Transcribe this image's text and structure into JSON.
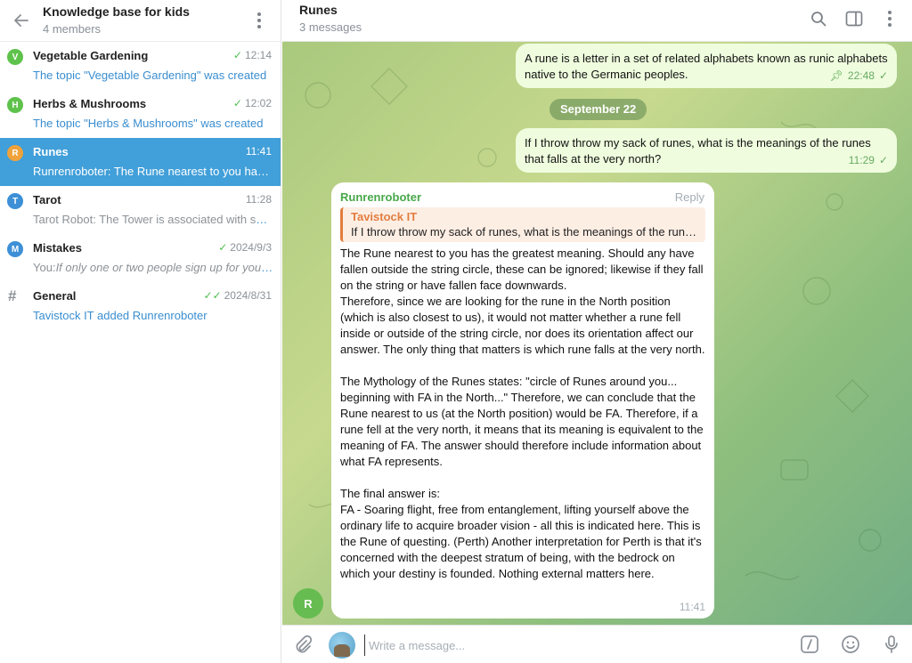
{
  "group": {
    "title": "Knowledge base for kids",
    "subtitle": "4 members"
  },
  "chats": [
    {
      "avatar_letter": "V",
      "avatar_color": "#5ec24b",
      "name": "Vegetable Gardening",
      "check": "✓",
      "time": "12:14",
      "sender": "",
      "preview": "The topic \"Vegetable Gardening\" was created"
    },
    {
      "avatar_letter": "H",
      "avatar_color": "#5ec24b",
      "name": "Herbs & Mushrooms",
      "check": "✓",
      "time": "12:02",
      "sender": "",
      "preview": "The topic \"Herbs & Mushrooms\" was created"
    },
    {
      "avatar_letter": "R",
      "avatar_color": "#f0a23b",
      "name": "Runes",
      "check": "",
      "time": "11:41",
      "sender": "",
      "preview": "Runrenroboter: The Rune nearest to you has the greatest meaning. Should any have",
      "active": true
    },
    {
      "avatar_letter": "T",
      "avatar_color": "#3d8fd6",
      "name": "Tarot",
      "check": "",
      "time": "11:28",
      "sender": "Tarot Robot:",
      "preview": " The Tower is associated with sudden change"
    },
    {
      "avatar_letter": "M",
      "avatar_color": "#3d8fd6",
      "name": "Mistakes",
      "check": "✓",
      "time": "2024/9/3",
      "sender": "You:",
      "preview": "If only one or two people sign up for your class"
    },
    {
      "avatar_letter": "#",
      "avatar_color": "",
      "name": "General",
      "check": "✓✓",
      "time": "2024/8/31",
      "sender": "",
      "preview": "Tavistock IT added Runrenroboter"
    }
  ],
  "topic": {
    "title": "Runes",
    "subtitle": "3 messages"
  },
  "messages": {
    "m1": {
      "text": "A rune is a letter in a set of related alphabets known as runic alphabets native to the Germanic peoples.",
      "time": "22:48",
      "check": "✓"
    },
    "date_separator": "September 22",
    "m2": {
      "text": "If I throw throw my sack of runes, what is the meanings of the runes that falls at the very north?",
      "time": "11:29",
      "check": "✓"
    },
    "m3": {
      "author": "Runrenroboter",
      "reply_label": "Reply",
      "quote_author": "Tavistock IT",
      "quote_text": "If I throw throw my sack of runes, what is the meanings of the runes that falls at the very north?",
      "para1": "The Rune nearest to you has the greatest meaning. Should any have fallen outside the string circle, these can be ignored; likewise if they fall on the string or have fallen face downwards.",
      "para2": "Therefore, since we are looking for the rune in the North position (which is also closest to us), it would not matter whether a rune fell inside or outside of the string circle, nor does its orientation affect our answer. The only thing that matters is which rune falls at the very north.",
      "para3": "The Mythology of the Runes states: \"circle of Runes around you... beginning with FA in the North...\" Therefore, we can conclude that the Rune nearest to us (at the North position) would be FA. Therefore, if a rune fell at the very north, it means that its meaning is equivalent to the meaning of FA. The answer should therefore include information about what FA represents.",
      "para4": "The final answer is:",
      "para5": "FA - Soaring flight, free from entanglement, lifting yourself above the ordinary life to acquire broader vision - all this is indicated here. This is the Rune of questing. (Perth) Another interpretation for Perth is that it's concerned with the deepest stratum of being, with the bedrock on which your destiny is founded. Nothing external matters here.",
      "time": "11:41",
      "avatar_letter": "R"
    }
  },
  "input": {
    "placeholder": "Write a message..."
  }
}
